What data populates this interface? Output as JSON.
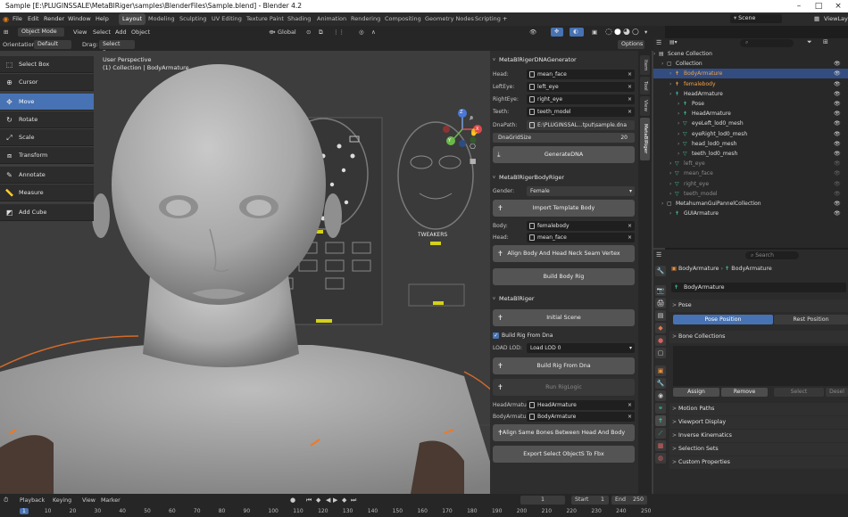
{
  "titlebar": {
    "title": "Sample [E:\\PLUGINSSALE\\MetaBlRiger\\samples\\BlenderFiles\\Sample.blend] - Blender 4.2"
  },
  "menubar": {
    "items": [
      "File",
      "Edit",
      "Render",
      "Window",
      "Help"
    ]
  },
  "workspaces": [
    "Layout",
    "Modeling",
    "Sculpting",
    "UV Editing",
    "Texture Paint",
    "Shading",
    "Animation",
    "Rendering",
    "Compositing",
    "Geometry Nodes",
    "Scripting"
  ],
  "scene": {
    "label": "Scene",
    "view_layer": "ViewLay"
  },
  "header3d": {
    "mode": "Object Mode",
    "menus": [
      "View",
      "Select",
      "Add",
      "Object"
    ],
    "transform": "Global"
  },
  "options_bar": {
    "orientation_label": "Orientation:",
    "orientation_value": "Default",
    "drag_label": "Drag:",
    "drag_value": "Select Box",
    "options": "Options"
  },
  "tools": [
    "Select Box",
    "Cursor",
    "Move",
    "Rotate",
    "Scale",
    "Transform",
    "Annotate",
    "Measure",
    "Add Cube"
  ],
  "viewport": {
    "view": "User Perspective",
    "collection": "(1) Collection | BodyArmature",
    "tweakers": "TWEAKERS"
  },
  "dna_panel": {
    "title": "MetaBlRigerDNAGenerator",
    "head_label": "Head:",
    "head": "mean_face",
    "lefteye_label": "LeftEye:",
    "lefteye": "left_eye",
    "righteye_label": "RightEye:",
    "righteye": "right_eye",
    "teeth_label": "Teeth:",
    "teeth": "teeth_model",
    "dnapath_label": "DnaPath:",
    "dnapath": "E:\\PLUGINSSAL...tput\\sample.dna",
    "gridsize_label": "DnaGridSize",
    "gridsize": "20",
    "generate": "GenerateDNA"
  },
  "body_panel": {
    "title": "MetaBlRigerBodyRiger",
    "gender_label": "Gender:",
    "gender": "Female",
    "import": "Import Template Body",
    "body_label": "Body:",
    "body": "femalebody",
    "head_label": "Head:",
    "head": "mean_face",
    "align": "Align Body And Head Neck Seam Vertex",
    "build": "Build Body Rig"
  },
  "riger_panel": {
    "title": "MetaBlRiger",
    "initial": "Initial Scene",
    "build_from_dna": "Build Rig From Dna",
    "load_lod_label": "LOAD LOD:",
    "load_lod": "Load LOD 0",
    "build_rig": "Build Rig From Dna",
    "run_riglogic": "Run RigLogic",
    "head_arm_label": "HeadArmatu...",
    "head_arm": "HeadArmature",
    "body_arm_label": "BodyArmatu...",
    "body_arm": "BodyArmature",
    "align_bones": "Align Same Bones Between Head And Body",
    "export": "Export Select ObjectS To Fbx"
  },
  "vtabs": [
    "Item",
    "Tool",
    "View",
    "MetaBlRiger"
  ],
  "outliner": {
    "search": "",
    "rows": [
      {
        "label": "Scene Collection",
        "indent": 0,
        "style": "normal"
      },
      {
        "label": "Collection",
        "indent": 1,
        "style": "normal"
      },
      {
        "label": "BodyArmature",
        "indent": 2,
        "style": "orange-sel"
      },
      {
        "label": "femalebody",
        "indent": 2,
        "style": "orange"
      },
      {
        "label": "HeadArmature",
        "indent": 2,
        "style": "normal"
      },
      {
        "label": "Pose",
        "indent": 3,
        "style": "normal"
      },
      {
        "label": "HeadArmature",
        "indent": 3,
        "style": "normal"
      },
      {
        "label": "eyeLeft_lod0_mesh",
        "indent": 3,
        "style": "normal"
      },
      {
        "label": "eyeRight_lod0_mesh",
        "indent": 3,
        "style": "normal"
      },
      {
        "label": "head_lod0_mesh",
        "indent": 3,
        "style": "normal"
      },
      {
        "label": "teeth_lod0_mesh",
        "indent": 3,
        "style": "normal"
      },
      {
        "label": "left_eye",
        "indent": 2,
        "style": "grey"
      },
      {
        "label": "mean_face",
        "indent": 2,
        "style": "grey"
      },
      {
        "label": "right_eye",
        "indent": 2,
        "style": "grey"
      },
      {
        "label": "teeth_model",
        "indent": 2,
        "style": "grey"
      },
      {
        "label": "MetahumanGuiPannelCollection",
        "indent": 1,
        "style": "normal"
      },
      {
        "label": "GUIArmature",
        "indent": 2,
        "style": "normal"
      }
    ],
    "badge1": "75",
    "badge2": "403"
  },
  "properties": {
    "search": "Search",
    "breadcrumb_obj": "BodyArmature",
    "breadcrumb_data": "BodyArmature",
    "data_name": "BodyArmature",
    "pose_section": "Pose",
    "pose_position": "Pose Position",
    "rest_position": "Rest Position",
    "bone_collections": "Bone Collections",
    "assign": "Assign",
    "remove": "Remove",
    "select": "Select",
    "deselect": "Desel",
    "sections": [
      "Motion Paths",
      "Viewport Display",
      "Inverse Kinematics",
      "Selection Sets",
      "Custom Properties"
    ]
  },
  "timeline": {
    "menus": [
      "Playback",
      "Keying",
      "View",
      "Marker"
    ],
    "current": "1",
    "start_label": "Start",
    "start": "1",
    "end_label": "End",
    "end": "250",
    "frames": [
      "1",
      "10",
      "20",
      "30",
      "40",
      "50",
      "60",
      "70",
      "80",
      "90",
      "100",
      "110",
      "120",
      "130",
      "140",
      "150",
      "160",
      "170",
      "180",
      "190",
      "200",
      "210",
      "220",
      "230",
      "240",
      "250"
    ]
  },
  "colors": {
    "accent": "#4772b3",
    "orange": "#f2a14a",
    "panel": "#2e2e2e"
  }
}
